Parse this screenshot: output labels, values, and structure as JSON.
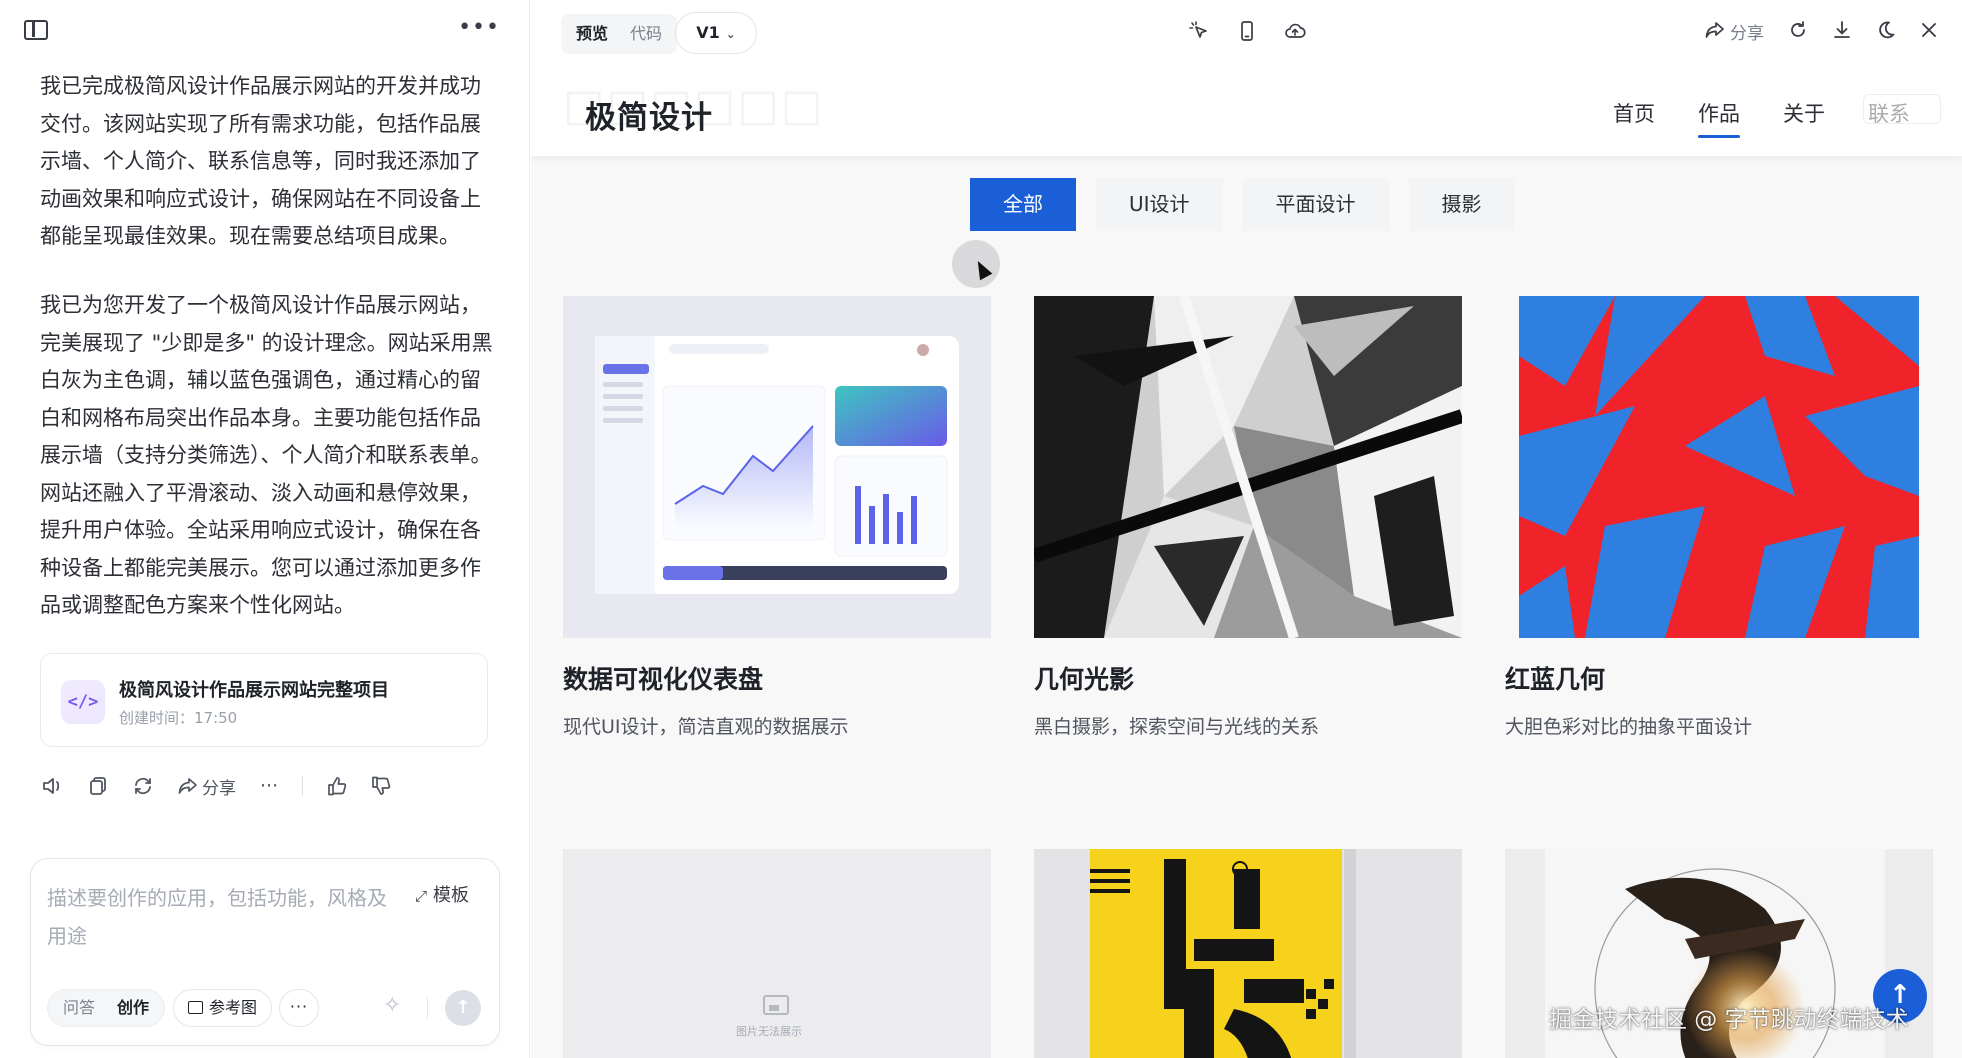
{
  "chat": {
    "message1": "我已完成极简风设计作品展示网站的开发并成功交付。该网站实现了所有需求功能，包括作品展示墙、个人简介、联系信息等，同时我还添加了动画效果和响应式设计，确保网站在不同设备上都能呈现最佳效果。现在需要总结项目成果。",
    "message2": "我已为您开发了一个极简风设计作品展示网站，完美展现了 \"少即是多\" 的设计理念。网站采用黑白灰为主色调，辅以蓝色强调色，通过精心的留白和网格布局突出作品本身。主要功能包括作品展示墙（支持分类筛选）、个人简介和联系表单。网站还融入了平滑滚动、淡入动画和悬停效果，提升用户体验。全站采用响应式设计，确保在各种设备上都能完美展示。您可以通过添加更多作品或调整配色方案来个性化网站。",
    "card": {
      "icon": "code-icon",
      "title": "极简风设计作品展示网站完整项目",
      "time": "创建时间：17:50"
    },
    "actions": {
      "share_label": "分享"
    }
  },
  "composer": {
    "placeholder": "描述要创作的应用，包括功能，风格及用途",
    "template_label": "模板",
    "modes": [
      "问答",
      "创作"
    ],
    "active_mode": "创作",
    "ref_image_label": "参考图"
  },
  "preview": {
    "tabs": [
      "预览",
      "代码"
    ],
    "active_tab": "预览",
    "version": "V1",
    "share_label": "分享"
  },
  "site": {
    "logo": "极简设计",
    "nav": [
      "首页",
      "作品",
      "关于",
      "联系"
    ],
    "active_nav": "作品",
    "filters": [
      "全部",
      "UI设计",
      "平面设计",
      "摄影"
    ],
    "active_filter": "全部",
    "works": [
      {
        "title": "数据可视化仪表盘",
        "desc": "现代UI设计，简洁直观的数据展示"
      },
      {
        "title": "几何光影",
        "desc": "黑白摄影，探索空间与光线的关系"
      },
      {
        "title": "红蓝几何",
        "desc": "大胆色彩对比的抽象平面设计"
      }
    ],
    "broken_image_label": "图片无法展示"
  },
  "watermark": "掘金技术社区 @ 字节跳动终端技术",
  "colors": {
    "accent": "#1a5fd8",
    "red": "#f0222a",
    "blue": "#2f7fe0",
    "poster_yellow": "#f6d21c"
  }
}
